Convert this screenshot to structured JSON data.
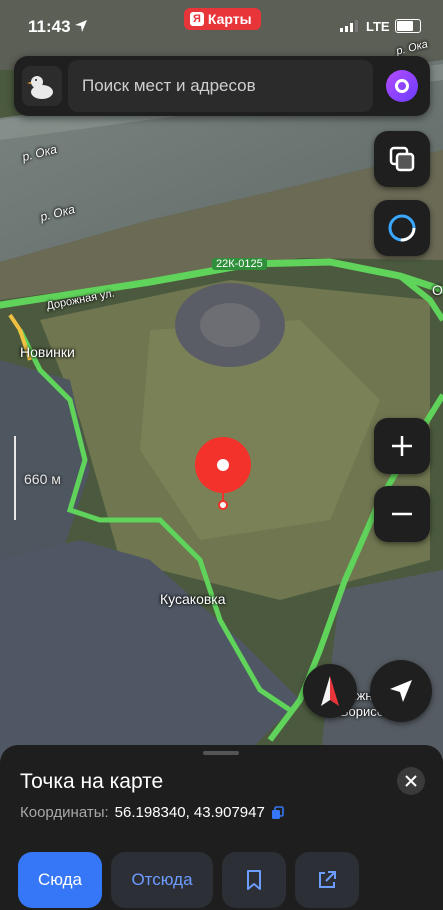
{
  "status_bar": {
    "time": "11:43",
    "network": "LTE"
  },
  "brand": {
    "ya": "Я",
    "name": "Карты"
  },
  "search": {
    "placeholder": "Поиск мест и адресов"
  },
  "map": {
    "labels": {
      "river1": "р. Ока",
      "river2": "р. Ока",
      "river3": "р. Ока",
      "road_number": "22К-0125",
      "street": "Дорожная ул.",
      "village1": "Новинки",
      "village2": "Кусаковка",
      "village3": "Нижнее Борисово",
      "edge": "О"
    },
    "scale": "660 м"
  },
  "colors": {
    "accent": "#3577f6",
    "pin": "#f2322b",
    "road": "#5fd35a",
    "panel": "#1e1e1e"
  },
  "icons": [
    "location-arrow-icon",
    "avatar-icon",
    "alice-icon",
    "layers-icon",
    "assistant-icon",
    "zoom-in-icon",
    "zoom-out-icon",
    "compass-icon",
    "my-location-icon",
    "close-icon",
    "copy-icon",
    "bookmark-icon",
    "share-icon"
  ],
  "sheet": {
    "title": "Точка на карте",
    "coords_label": "Координаты:",
    "coords_value": "56.198340, 43.907947",
    "btn_here": "Сюда",
    "btn_from": "Отсюда"
  }
}
